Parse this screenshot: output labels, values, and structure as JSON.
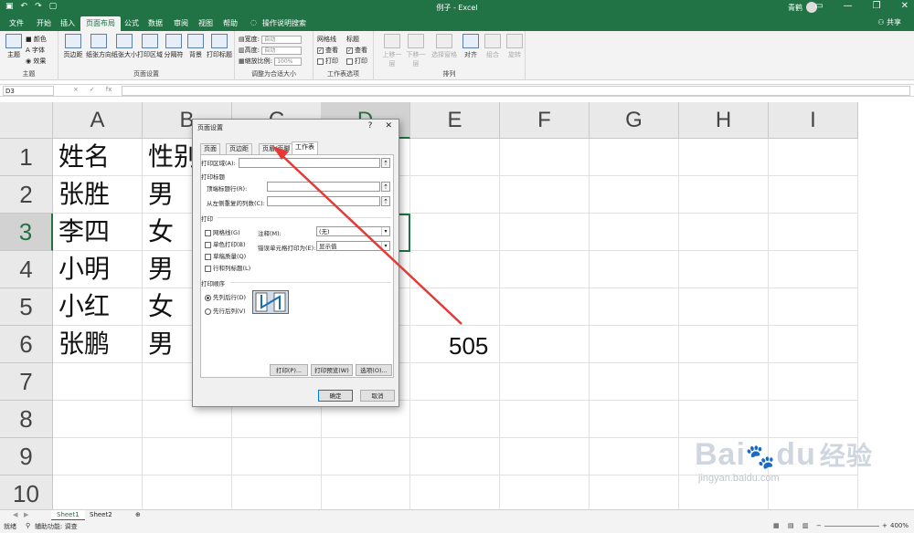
{
  "titlebar": {
    "title": "例子 - Excel",
    "user": "青鹤",
    "qat_icons": [
      "save-icon",
      "undo-icon",
      "redo-icon",
      "new-file-icon"
    ],
    "window_controls": [
      "ribbon-options-icon",
      "minimize-icon",
      "restore-icon",
      "close-icon"
    ]
  },
  "ribbon_tabs": [
    {
      "label": "文件"
    },
    {
      "label": "开始"
    },
    {
      "label": "插入"
    },
    {
      "label": "页面布局"
    },
    {
      "label": "公式"
    },
    {
      "label": "数据"
    },
    {
      "label": "审阅"
    },
    {
      "label": "视图"
    },
    {
      "label": "帮助"
    },
    {
      "label": "操作说明搜索"
    }
  ],
  "active_tab": "页面布局",
  "share": "共享",
  "ribbon": {
    "theme": {
      "big": "主题",
      "colors": "颜色",
      "fonts": "字体",
      "effects": "效果",
      "label": "主题"
    },
    "page_setup": {
      "buttons": [
        "页边距",
        "纸张方向",
        "纸张大小",
        "打印区域",
        "分隔符",
        "背景",
        "打印标题"
      ],
      "label": "页面设置"
    },
    "scale": {
      "width_label": "宽度:",
      "width_val": "自动",
      "height_label": "高度:",
      "height_val": "自动",
      "scale_label": "缩放比例:",
      "scale_val": "100%",
      "label": "调整为合适大小"
    },
    "sheet_options": {
      "gridlines": "网格线",
      "headings": "标题",
      "view": "查看",
      "print": "打印",
      "label": "工作表选项"
    },
    "arrange": {
      "buttons": [
        "上移一层",
        "下移一层",
        "选择窗格",
        "对齐",
        "组合",
        "旋转"
      ],
      "label": "排列"
    }
  },
  "formula_bar": {
    "namebox": "D3",
    "fx": "fx",
    "cancel": "×",
    "enter": "✓",
    "content": ""
  },
  "columns": [
    "A",
    "B",
    "C",
    "D",
    "E",
    "F",
    "G",
    "H",
    "I"
  ],
  "selected_column": "D",
  "rows": [
    "1",
    "2",
    "3",
    "4",
    "5",
    "6",
    "7",
    "8",
    "9",
    "10"
  ],
  "selected_row": "3",
  "cells": {
    "A": [
      "姓名",
      "张胜",
      "李四",
      "小明",
      "小红",
      "张鹏"
    ],
    "B": [
      "性别",
      "男",
      "女",
      "男",
      "女",
      "男"
    ]
  },
  "annotation_number": "505",
  "sheets": [
    {
      "label": "Sheet1"
    },
    {
      "label": "Sheet2"
    }
  ],
  "status": {
    "ready": "就绪",
    "accessibility": "辅助功能: 调查",
    "zoom": "400%"
  },
  "dialog": {
    "title": "页面设置",
    "help": "?",
    "close": "✕",
    "tabs": [
      "页面",
      "页边距",
      "页眉/页脚",
      "工作表"
    ],
    "active_tab": "工作表",
    "print_area_label": "打印区域(A):",
    "print_titles_label": "打印标题",
    "top_rows_label": "顶端标题行(R):",
    "left_cols_label": "从左侧重复的列数(C):",
    "print_section": "打印",
    "gridlines": "网格线(G)",
    "monochrome": "单色打印(B)",
    "draft": "草稿质量(Q)",
    "rowcol_headings": "行和列标题(L)",
    "comments_label": "注释(M):",
    "comments_val": "(无)",
    "errors_label": "错误单元格打印为(E):",
    "errors_val": "显示值",
    "order_section": "打印顺序",
    "down_then_over": "先列后行(D)",
    "over_then_down": "先行后列(V)",
    "print_btn": "打印(P)...",
    "preview_btn": "打印预览(W)",
    "options_btn": "选项(O)...",
    "ok_btn": "确定",
    "cancel_btn": "取消"
  },
  "watermark": {
    "brand": "Bai",
    "brand2": "du",
    "cn": "经验",
    "url": "jingyan.baidu.com"
  }
}
